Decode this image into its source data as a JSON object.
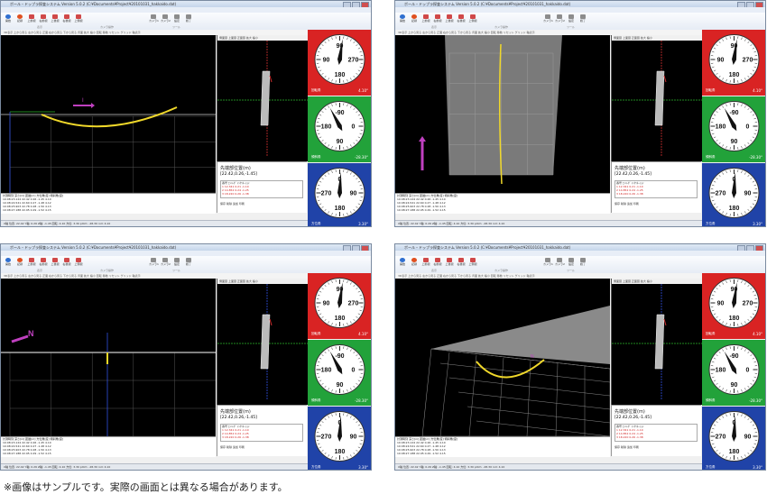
{
  "window": {
    "title": "ポール・ドップラ探査システム  Version 5.0.2  (C:¥Documents¥Project¥20101031_hakkaido.dat)",
    "menu": [
      "ファイル",
      "編集",
      "表示",
      "データ分析",
      "画像",
      "ヘルプ"
    ],
    "ribbon_buttons": [
      {
        "label": "開始",
        "kind": "play"
      },
      {
        "label": "記録",
        "kind": "rec"
      },
      {
        "label": "上前視",
        "kind": "red"
      },
      {
        "label": "右前視",
        "kind": "red"
      },
      {
        "label": "上後視",
        "kind": "red"
      },
      {
        "label": "右後視",
        "kind": "red"
      },
      {
        "label": "上側視",
        "kind": "red"
      },
      {
        "label": "カメラ1",
        "kind": "gray"
      },
      {
        "label": "カメラ2",
        "kind": "gray"
      },
      {
        "label": "設定",
        "kind": "gray"
      },
      {
        "label": "終了",
        "kind": "gray"
      }
    ],
    "ribbon_groups": [
      "表示",
      "カメラ操作",
      "ツール"
    ],
    "subtoolbar": "3D表示  上から見る  左から見る  正面  右から見る  下から見る  背面  拡大  縮小  回転  移動  リセット  グリッド  軸表示",
    "side_toolbar": "側面図  上面図  正面図  拡大  縮小",
    "position_label": "先端部位置(m)",
    "position_value": "[22.42,0.26,-1.45]",
    "table_header": "番号     ｴﾝｺｰﾀﾞ   ｲﾝｸﾘﾈｰｼｮﾝ",
    "table_rows": [
      "1  12.341  0.21  -1.10",
      "2  14.852  0.24  -1.25",
      "3  18.220  0.26  -1.38"
    ],
    "posbox_footer": "保存   削除   追加   印刷",
    "data_header": "計測時刻     深さ[m]  距離[m]  方位角[度]  傾斜角[度]",
    "data_rows": [
      "10:08:23.124  22.42   0.26   -1.45   4.10",
      "10:08:24.541  22.60   0.27   -1.48   4.12",
      "10:08:25.903  22.78   0.28   -1.50   4.13",
      "10:08:27.188  22.95   0.29   -1.52   4.15"
    ],
    "status_left": "X軸 位置: 22.42  Y軸: 0.26  Z軸: -1.45  回転: 4.10  方位: 3.30  pitch: -28.30  roll: 4.10",
    "status_right": "CAP  NUM  SCRL"
  },
  "gauges": [
    {
      "name": "roll",
      "label": "回転角",
      "value": "4.10°",
      "color": "#d92323",
      "top": "90",
      "left": "90",
      "right": "270",
      "bottom": "180",
      "needle_deg": 8
    },
    {
      "name": "pitch",
      "label": "傾斜角",
      "value": "-28.30°",
      "color": "#22a23a",
      "top": "-90",
      "left": "180",
      "right": "0",
      "bottom": "90",
      "needle_deg": -28
    },
    {
      "name": "heading",
      "label": "方位角",
      "value": "3.30°",
      "color": "#2043a8",
      "top": "0",
      "left": "270",
      "right": "90",
      "bottom": "180",
      "needle_deg": 3
    }
  ],
  "views": [
    {
      "id": "v1",
      "mode": "side",
      "compass": "I"
    },
    {
      "id": "v2",
      "mode": "front",
      "compass": "I"
    },
    {
      "id": "v3",
      "mode": "top",
      "compass": "N"
    },
    {
      "id": "v4",
      "mode": "persp",
      "compass": "N"
    }
  ],
  "caption": "※画像はサンプルです。実際の画面とは異なる場合があります。",
  "colors": {
    "path": "#f0d82a",
    "axis_x": "#2db52d",
    "axis_y": "#3050e0",
    "axis_z": "#d03030",
    "compass": "#c040c0"
  }
}
